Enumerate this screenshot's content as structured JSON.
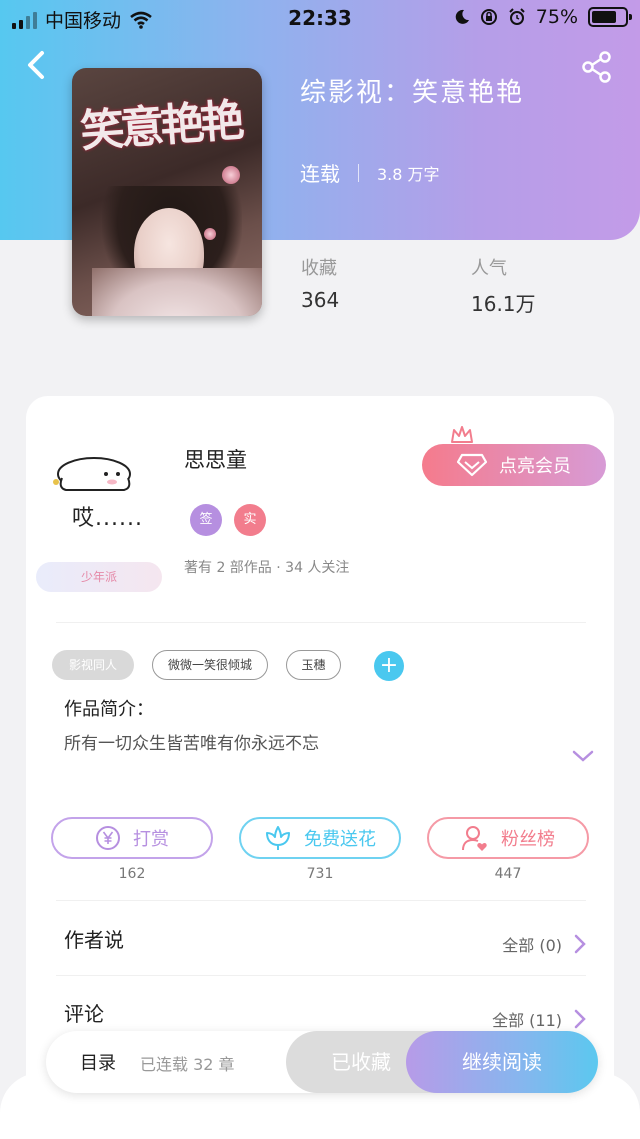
{
  "status_bar": {
    "carrier": "中国移动",
    "time": "22:33",
    "battery": "75%",
    "battery_level": 0.75,
    "icons": [
      "signal-icon",
      "wifi-icon",
      "moon-icon",
      "orientation-lock-icon",
      "alarm-icon",
      "battery-icon"
    ]
  },
  "book": {
    "title": "综影视：笑意艳艳",
    "status": "连载",
    "word_count": "3.8 万字",
    "cover_text": "笑意艳艳",
    "stats": [
      {
        "label": "收藏",
        "value": "364"
      },
      {
        "label": "人气",
        "value": "16.1万"
      }
    ]
  },
  "author": {
    "avatar_caption": "哎......",
    "badge": "少年派",
    "name": "思思童",
    "tags": [
      {
        "label": "签",
        "color": "#b68fe0"
      },
      {
        "label": "实",
        "color": "#f27d8d"
      }
    ],
    "meta": "著有 2 部作品 · 34 人关注",
    "vip_button": "点亮会员"
  },
  "chips": {
    "category": "影视同人",
    "items": [
      "微微一笑很倾城",
      "玉穗"
    ],
    "add": "+"
  },
  "intro": {
    "label": "作品简介：",
    "text": "所有一切众生皆苦唯有你永远不忘"
  },
  "actions": [
    {
      "label": "打赏",
      "count": "162",
      "icon": "yen-icon",
      "color": "#b68fe0"
    },
    {
      "label": "免费送花",
      "count": "731",
      "icon": "flower-icon",
      "color": "#4ac8ef"
    },
    {
      "label": "粉丝榜",
      "count": "447",
      "icon": "fan-user-icon",
      "color": "#f27d8d"
    }
  ],
  "sections": {
    "author_says": {
      "title": "作者说",
      "more": "全部 (0)"
    },
    "comments": {
      "title": "评论",
      "more": "全部 (11)"
    }
  },
  "bottom_bar": {
    "toc": "目录",
    "chapters": "已连载 32 章",
    "collected": "已收藏",
    "continue": "继续阅读"
  }
}
